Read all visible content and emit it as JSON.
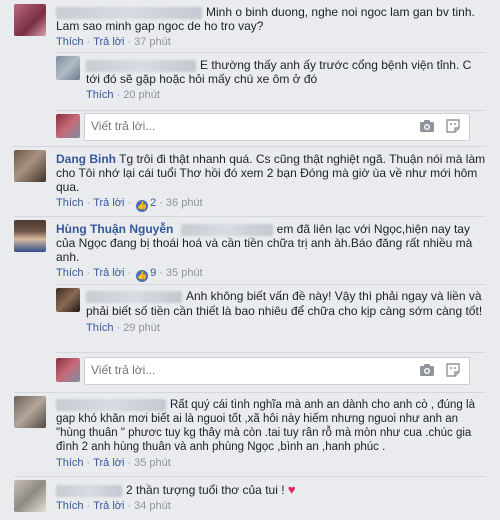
{
  "actions": {
    "like": "Thích",
    "reply": "Trả lời"
  },
  "reply_placeholder": "Viết trả lời...",
  "comments": [
    {
      "author": "",
      "text": "Minh o binh duong, nghe noi ngoc lam gan bv tinh. Lam sao minh gap ngoc de ho tro vay?",
      "time": "37 phút",
      "replies": [
        {
          "author": "",
          "text": "E thường thấy anh ấy trước cổng bệnh viện tỉnh. C tới đó sẽ gặp hoặc hỏi mấy chú xe ôm ở đó",
          "time": "20 phút"
        }
      ]
    },
    {
      "author": "Dang Binh",
      "text": "Tg trôi đi thật nhanh quá. Cs cũng thật nghiệt ngã. Thuận nói mà làm cho Tôi nhớ lại cái tuổi Thơ hồi đó xem 2 bạn Đóng mà giờ ùa về như mới hôm qua.",
      "likes": "2",
      "time": "36 phút"
    },
    {
      "author": "Hùng Thuận Nguyễn",
      "text": "em đã liên lạc với Ngọc,hiện nay tay của Ngọc đang bị thoái hoá và cần tiền chữa trị anh àh.Báo đăng rất nhiều mà anh.",
      "likes": "9",
      "time": "35 phút",
      "replies": [
        {
          "author": "",
          "text": "Anh không biết vấn đề này! Vậy thì phải ngay và liền và phải biết số tiền cần thiết là bao nhiêu để chữa cho kịp càng sớm càng tốt!",
          "time": "29 phút"
        }
      ]
    },
    {
      "author": "",
      "text": "Rất quý cái tình nghĩa mà anh an dành cho anh cò , đúng là gap khó khăn mơi biết ai là nguoi tốt ,xã hôi này hiếm nhưng nguoi như anh an \"hùng thuân \" phươc tuy kg thây mà còn .tai tuy rân rỗ mà mòn như cua .chúc gia đình 2 anh hùng thuân và anh phùng Ngọc ,bình an ,hanh phúc .",
      "time": "35 phút"
    },
    {
      "author": "",
      "text": "2 thần tượng tuổi thơ của tui !",
      "emoji": "♥",
      "time": "34 phút"
    }
  ]
}
